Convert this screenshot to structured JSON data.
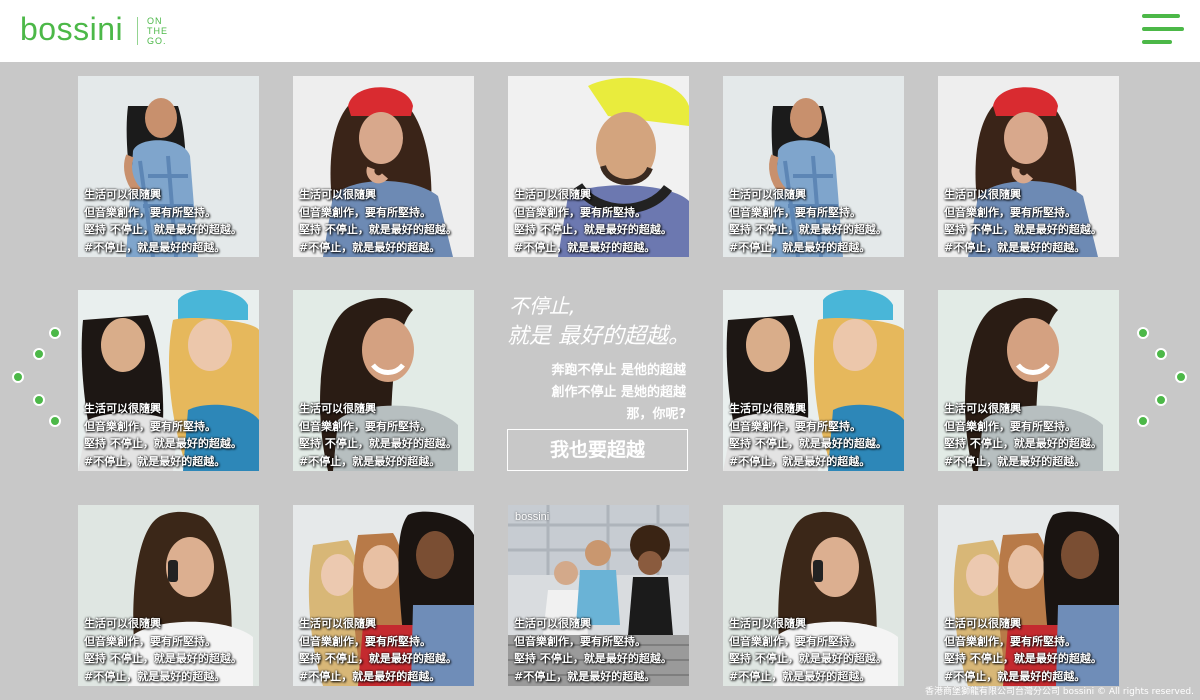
{
  "header": {
    "logo_word": "bossini",
    "tagline": [
      "ON",
      "THE",
      "GO."
    ]
  },
  "tile_caption": {
    "line1": "生活可以很隨興",
    "line2": "但音樂創作，要有所堅持。",
    "line3": "堅持 不停止，就是最好的超越。",
    "line4": "#不停止，就是最好的超越。"
  },
  "center_promo": {
    "headline1": "不停止,",
    "headline2": "就是 最好的超越。",
    "body1": "奔跑不停止 是他的超越",
    "body2": "創作不停止 是她的超越",
    "body3": "那，你呢?",
    "cta_label": "我也要超越"
  },
  "mini_logo": "bossini",
  "footer": "香港商堡獅龍有限公司台灣分公司 bossini © All rights reserved.",
  "colors": {
    "accent": "#4cb848",
    "page_bg": "#c8c8c8",
    "header_bg": "#ffffff"
  }
}
